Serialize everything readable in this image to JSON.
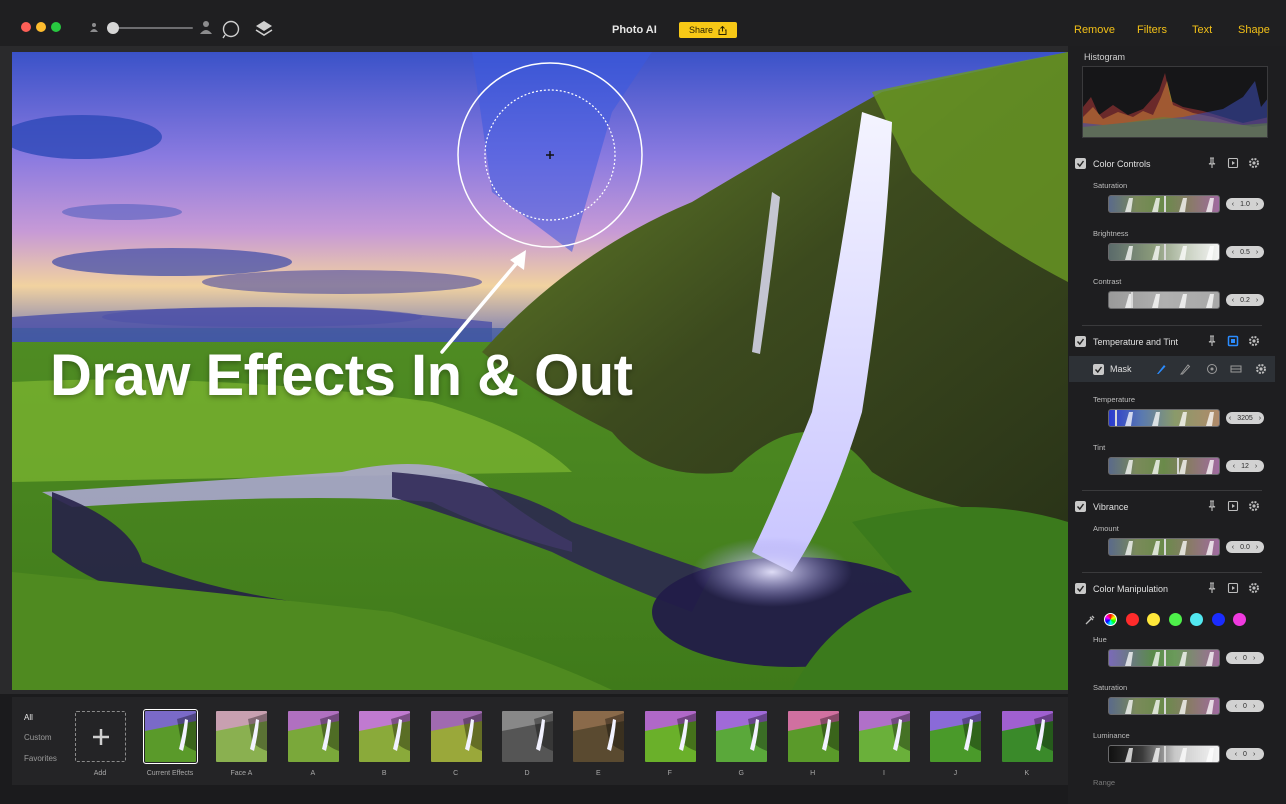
{
  "titlebar": {
    "app_title": "Photo AI",
    "share_label": "Share",
    "nav": [
      "Remove",
      "Filters",
      "Text",
      "Shape"
    ]
  },
  "canvas": {
    "headline": "Draw Effects In & Out"
  },
  "filters": {
    "categories": [
      "All",
      "Custom",
      "Favorites"
    ],
    "active_category": "All",
    "add_label": "Add",
    "presets": [
      "Current Effects",
      "Face A",
      "A",
      "B",
      "C",
      "D",
      "E",
      "F",
      "G",
      "H",
      "I",
      "J",
      "K"
    ]
  },
  "panel": {
    "histogram_title": "Histogram",
    "color_controls": {
      "title": "Color Controls",
      "saturation": {
        "label": "Saturation",
        "value": "1.0"
      },
      "brightness": {
        "label": "Brightness",
        "value": "0.5"
      },
      "contrast": {
        "label": "Contrast",
        "value": "0.2"
      }
    },
    "temperature_tint": {
      "title": "Temperature and Tint",
      "mask_label": "Mask",
      "temperature": {
        "label": "Temperature",
        "value": "3205"
      },
      "tint": {
        "label": "Tint",
        "value": "12"
      }
    },
    "vibrance": {
      "title": "Vibrance",
      "amount": {
        "label": "Amount",
        "value": "0.0"
      }
    },
    "color_manipulation": {
      "title": "Color Manipulation",
      "swatches": [
        "#ff2b2b",
        "#ffe83a",
        "#4ef04a",
        "#52e8f0",
        "#1a2cff",
        "#f03adf"
      ],
      "hue": {
        "label": "Hue",
        "value": "0"
      },
      "saturation": {
        "label": "Saturation",
        "value": "0"
      },
      "luminance": {
        "label": "Luminance",
        "value": "0"
      },
      "range_label": "Range"
    }
  },
  "colors": {
    "accent": "#f7c816",
    "nav_text": "#f2c018",
    "selected_mask": "#2b8cff"
  }
}
